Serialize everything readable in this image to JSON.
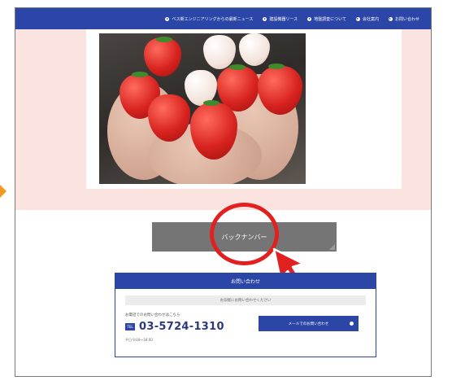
{
  "nav": {
    "items": [
      {
        "label": "ベス新エンジニアリングからの最新ニュース"
      },
      {
        "label": "建設機器リース"
      },
      {
        "label": "地盤調査について"
      },
      {
        "label": "会社案内"
      },
      {
        "label": "お問い合わせ"
      }
    ]
  },
  "main": {
    "backnumber_label": "バックナンバー"
  },
  "contact": {
    "title": "お問い合わせ",
    "subtitle": "お気軽にお問い合わせください",
    "note": "お電話でのお問い合わせはこちら",
    "tel_badge": "TEL",
    "tel_number": "03-5724-1310",
    "hours": "平日 9:00〜18:00",
    "form_button": "メールでのお問い合わせ"
  },
  "colors": {
    "brand": "#2b46a6",
    "hero_band": "#fbe4e0",
    "button_gray": "#757575",
    "highlight": "#e32020",
    "marker": "#f39a1e"
  }
}
